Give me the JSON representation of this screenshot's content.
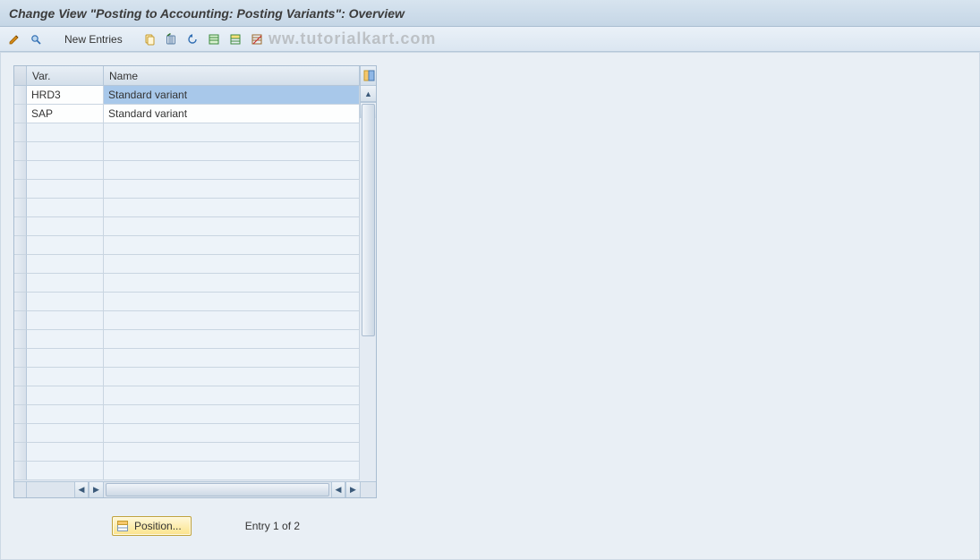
{
  "title": "Change View \"Posting to Accounting: Posting Variants\": Overview",
  "toolbar": {
    "new_entries": "New Entries"
  },
  "watermark": "ww.tutorialkart.com",
  "table": {
    "columns": {
      "var": "Var.",
      "name": "Name"
    },
    "rows": [
      {
        "var": "HRD3",
        "name": "Standard variant",
        "selected": true
      },
      {
        "var": "SAP",
        "name": "Standard variant",
        "selected": false
      }
    ],
    "empty_rows": 19
  },
  "footer": {
    "position_label": "Position...",
    "entry_text": "Entry 1 of 2"
  }
}
